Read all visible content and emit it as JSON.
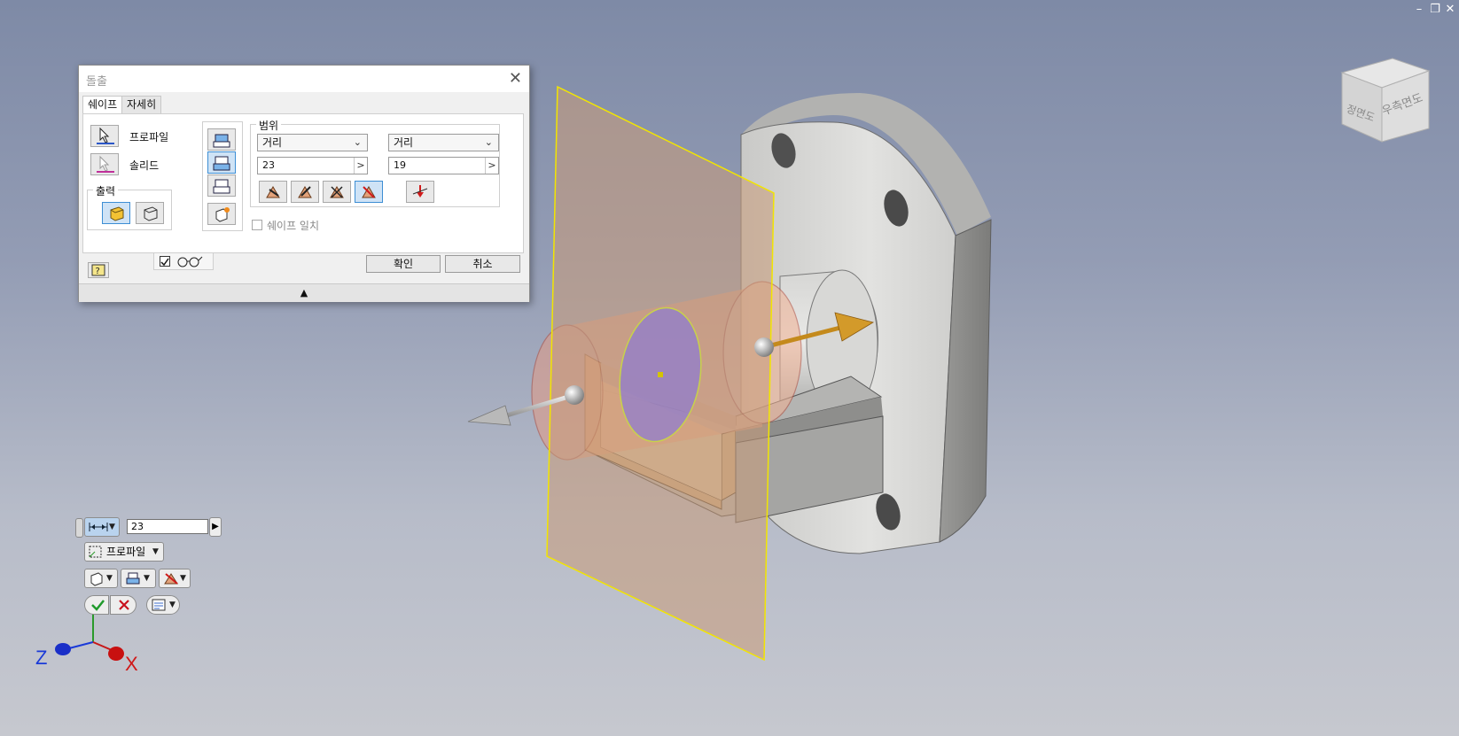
{
  "window_controls": {
    "minimize": "–",
    "restore": "❐",
    "close": "✕"
  },
  "viewcube": {
    "front_label": "정면도",
    "right_label": "우측면도"
  },
  "dialog": {
    "title": "돌출",
    "close_glyph": "✕",
    "tabs": [
      {
        "label": "쉐이프"
      },
      {
        "label": "자세히"
      }
    ],
    "profile_label": "프로파일",
    "solid_label": "솔리드",
    "output_label": "출력",
    "extent": {
      "group_label": "범위",
      "distance_a": {
        "type": "거리",
        "value": "23"
      },
      "distance_b": {
        "type": "거리",
        "value": "19"
      }
    },
    "match_shape_label": "쉐이프 일치",
    "ok_label": "확인",
    "cancel_label": "취소",
    "expand_glyph": "▲"
  },
  "mini_toolbar": {
    "distance_value": "23",
    "profile_label": "프로파일"
  },
  "triad": {
    "z_label": "Z",
    "x_label": "X"
  },
  "colors": {
    "accent_selected": "#cfe3f6",
    "sketch_plane": "#f2e500",
    "extrude_preview": "#e8a080",
    "direction_arrow": "#c48a1c",
    "ok_check": "#1f9a2c",
    "cancel_x": "#c8101e"
  }
}
